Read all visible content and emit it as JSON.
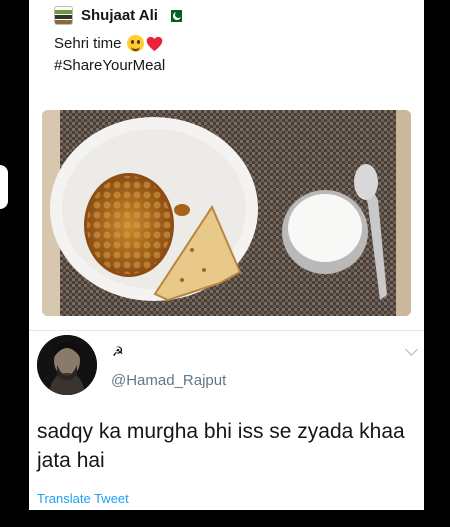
{
  "quoted_tweet": {
    "author_name": "Shujaat Ali",
    "line1": "Sehri time",
    "line2": "#ShareYourMeal",
    "emojis": [
      "smiling-face-icon",
      "red-heart-icon"
    ],
    "flag": "pakistan-flag-icon"
  },
  "reply": {
    "badge": "☭",
    "handle": "@Hamad_Rajput",
    "text": "sadqy ka murgha bhi iss se zyada khaa jata hai",
    "translate_label": "Translate Tweet"
  },
  "colors": {
    "link": "#1da1f2",
    "muted": "#657786",
    "text": "#14171a",
    "background": "#000000"
  }
}
